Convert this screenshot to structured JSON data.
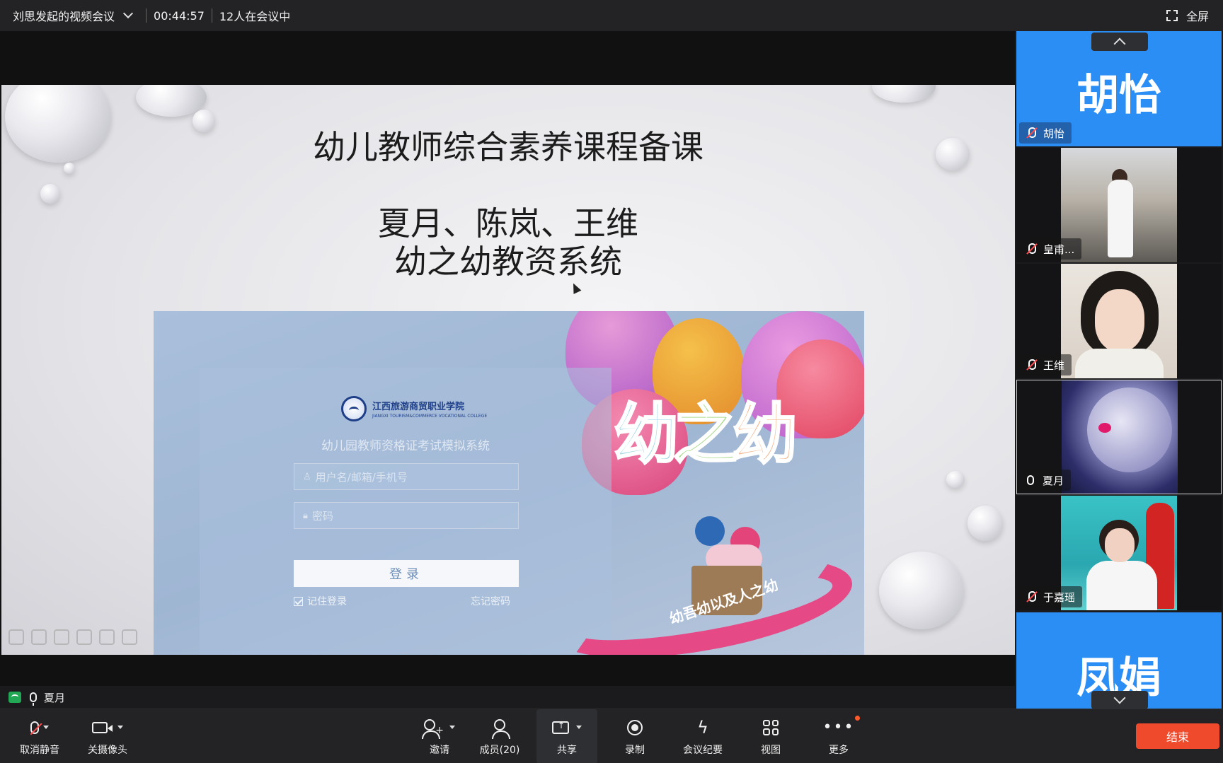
{
  "topbar": {
    "meeting_title": "刘思发起的视频会议",
    "timer": "00:44:57",
    "participants_status": "12人在会议中",
    "fullscreen_label": "全屏"
  },
  "slide": {
    "title": "幼儿教师综合素养课程备课",
    "names": "夏月、陈岚、王维",
    "system": "幼之幼教资系统",
    "login": {
      "school_name": "江西旅游商贸职业学院",
      "school_name_en": "JIANGXI TOURISM&COMMERCE VOCATIONAL COLLEGE",
      "system_title": "幼儿园教师资格证考试模拟系统",
      "username_placeholder": "用户名/邮箱/手机号",
      "password_placeholder": "密码",
      "login_button": "登录",
      "remember_label": "记住登录",
      "forgot_label": "忘记密码",
      "art_text": [
        "幼",
        "之",
        "幼"
      ],
      "ribbon_text": "幼吾幼以及人之幼"
    }
  },
  "speaker": {
    "name": "夏月"
  },
  "participants": [
    {
      "name": "胡怡",
      "display": "胡怡",
      "avatar_text": "胡怡",
      "muted": true,
      "has_video": false
    },
    {
      "name": "皇甫...",
      "display": "皇甫...",
      "muted": true,
      "has_video": true
    },
    {
      "name": "王维",
      "display": "王维",
      "muted": true,
      "has_video": true
    },
    {
      "name": "夏月",
      "display": "夏月",
      "muted": false,
      "has_video": true,
      "active": true
    },
    {
      "name": "于嘉瑶",
      "display": "于嘉瑶",
      "muted": true,
      "has_video": true
    },
    {
      "name": "凤娟",
      "avatar_text": "凤娟",
      "muted": true,
      "has_video": false
    }
  ],
  "toolbar": {
    "unmute": "取消静音",
    "camera_off": "关摄像头",
    "invite": "邀请",
    "members": "成员(20)",
    "share": "共享",
    "record": "录制",
    "minutes": "会议纪要",
    "view": "视图",
    "more": "更多",
    "end": "结束"
  },
  "colors": {
    "accent_blue": "#2b8ef5",
    "end_red": "#f04a2c",
    "mute_red": "#ff4d4f",
    "network_green": "#22a855"
  },
  "icons": {
    "fullscreen": "fullscreen-icon",
    "mic_muted": "mic-muted-icon",
    "mic": "mic-icon",
    "camera": "camera-icon",
    "invite": "add-user-icon",
    "members": "members-icon",
    "share": "share-screen-icon",
    "record": "record-icon",
    "minutes": "ai-minutes-icon",
    "view": "grid-view-icon",
    "more": "more-icon"
  }
}
